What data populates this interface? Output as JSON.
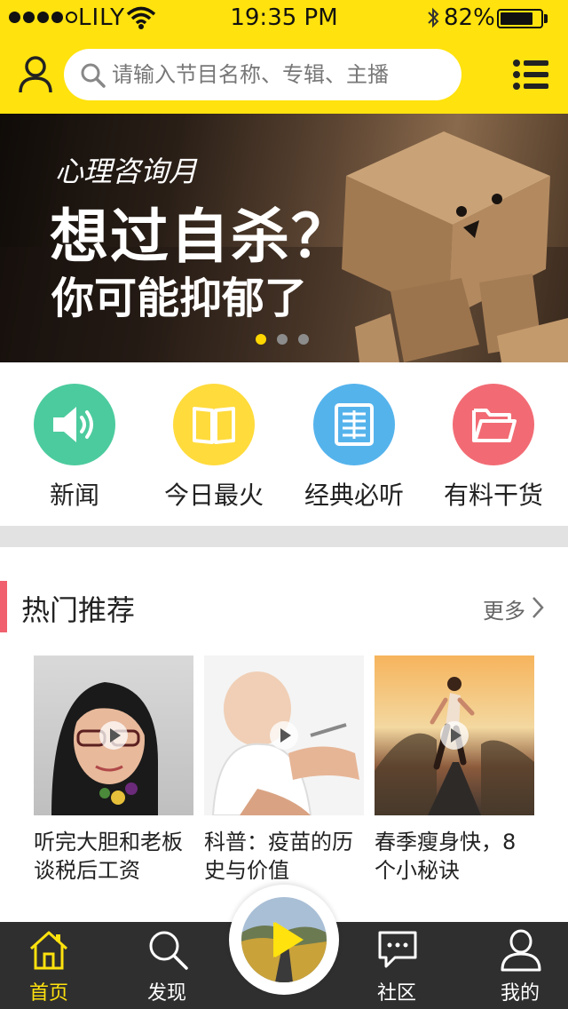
{
  "status_bar": {
    "carrier": "LILY",
    "time": "19:35 PM",
    "battery": "82%",
    "battery_level": 0.82
  },
  "header": {
    "search_placeholder": "请输入节目名称、专辑、主播",
    "user_icon": "user-icon",
    "menu_icon": "list-menu-icon"
  },
  "banner": {
    "tag": "心理咨询月",
    "title": "想过自杀？",
    "subtitle": "你可能抑郁了",
    "page_count": 3,
    "active_page": 1
  },
  "categories": [
    {
      "label": "新闻",
      "icon": "speaker-icon",
      "color": "#4CCB9E"
    },
    {
      "label": "今日最火",
      "icon": "book-icon",
      "color": "#FFDB3C"
    },
    {
      "label": "经典必听",
      "icon": "newspaper-icon",
      "color": "#55B3EC"
    },
    {
      "label": "有料干货",
      "icon": "folder-icon",
      "color": "#F26B74"
    }
  ],
  "section": {
    "title": "热门推荐",
    "more": "更多"
  },
  "recommendations": [
    {
      "title": "听完大胆和老板谈税后工资"
    },
    {
      "title": "科普：疫苗的历史与价值"
    },
    {
      "title": "春季瘦身快，8个小秘诀"
    }
  ],
  "tabs": [
    {
      "label": "首页",
      "icon": "home-icon",
      "active": true
    },
    {
      "label": "发现",
      "icon": "search-icon",
      "active": false
    },
    {
      "label": "社区",
      "icon": "chat-icon",
      "active": false
    },
    {
      "label": "我的",
      "icon": "person-icon",
      "active": false
    }
  ],
  "colors": {
    "brand_yellow": "#FFE20E",
    "accent_red": "#F0606E",
    "tabbar_bg": "#2f2f2f"
  }
}
